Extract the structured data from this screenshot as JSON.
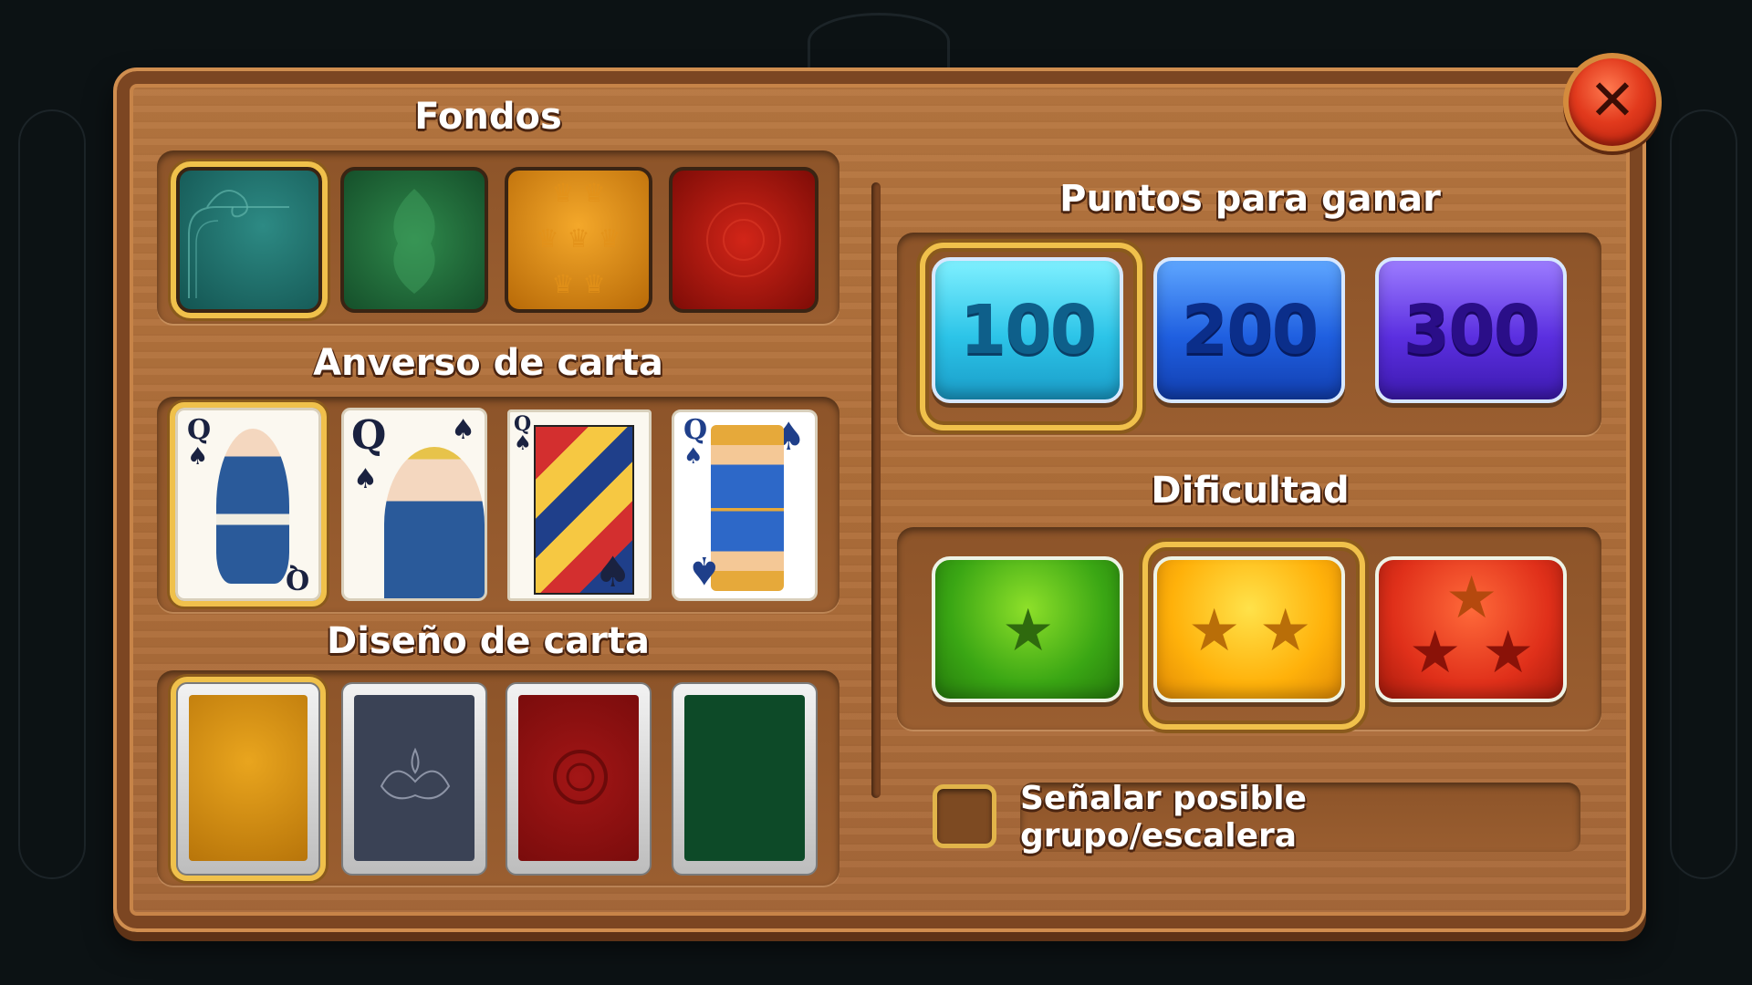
{
  "sections": {
    "backgrounds_title": "Fondos",
    "card_face_title": "Anverso de carta",
    "card_design_title": "Diseño de carta",
    "points_title": "Puntos para ganar",
    "difficulty_title": "Dificultad"
  },
  "backgrounds": [
    {
      "name": "teal-swirl",
      "color": "#1f6a66",
      "selected": true
    },
    {
      "name": "green-damask",
      "color": "#1f6e3a",
      "selected": false
    },
    {
      "name": "orange-crown",
      "color": "#d9880f",
      "selected": false
    },
    {
      "name": "red-floral",
      "color": "#a5160f",
      "selected": false
    }
  ],
  "card_faces": [
    {
      "rank": "Q",
      "suit": "♠",
      "selected": true
    },
    {
      "rank": "Q",
      "suit": "♠",
      "selected": false
    },
    {
      "rank": "Q",
      "suit": "♠",
      "selected": false
    },
    {
      "rank": "Q",
      "suit": "♠",
      "selected": false
    }
  ],
  "card_backs": [
    {
      "color": "#d6950e",
      "selected": true
    },
    {
      "color": "#3a4255",
      "selected": false
    },
    {
      "color": "#8e1010",
      "selected": false
    },
    {
      "color": "#0d4a28",
      "selected": false
    }
  ],
  "points_options": [
    {
      "label": "100",
      "selected": true
    },
    {
      "label": "200",
      "selected": false
    },
    {
      "label": "300",
      "selected": false
    }
  ],
  "difficulty_options": [
    {
      "stars": 1,
      "color": "green",
      "selected": false
    },
    {
      "stars": 2,
      "color": "orange",
      "selected": true
    },
    {
      "stars": 3,
      "color": "red",
      "selected": false
    }
  ],
  "hint_option": {
    "label": "Señalar posible grupo/escalera",
    "checked": false
  },
  "close_icon": "close-icon"
}
